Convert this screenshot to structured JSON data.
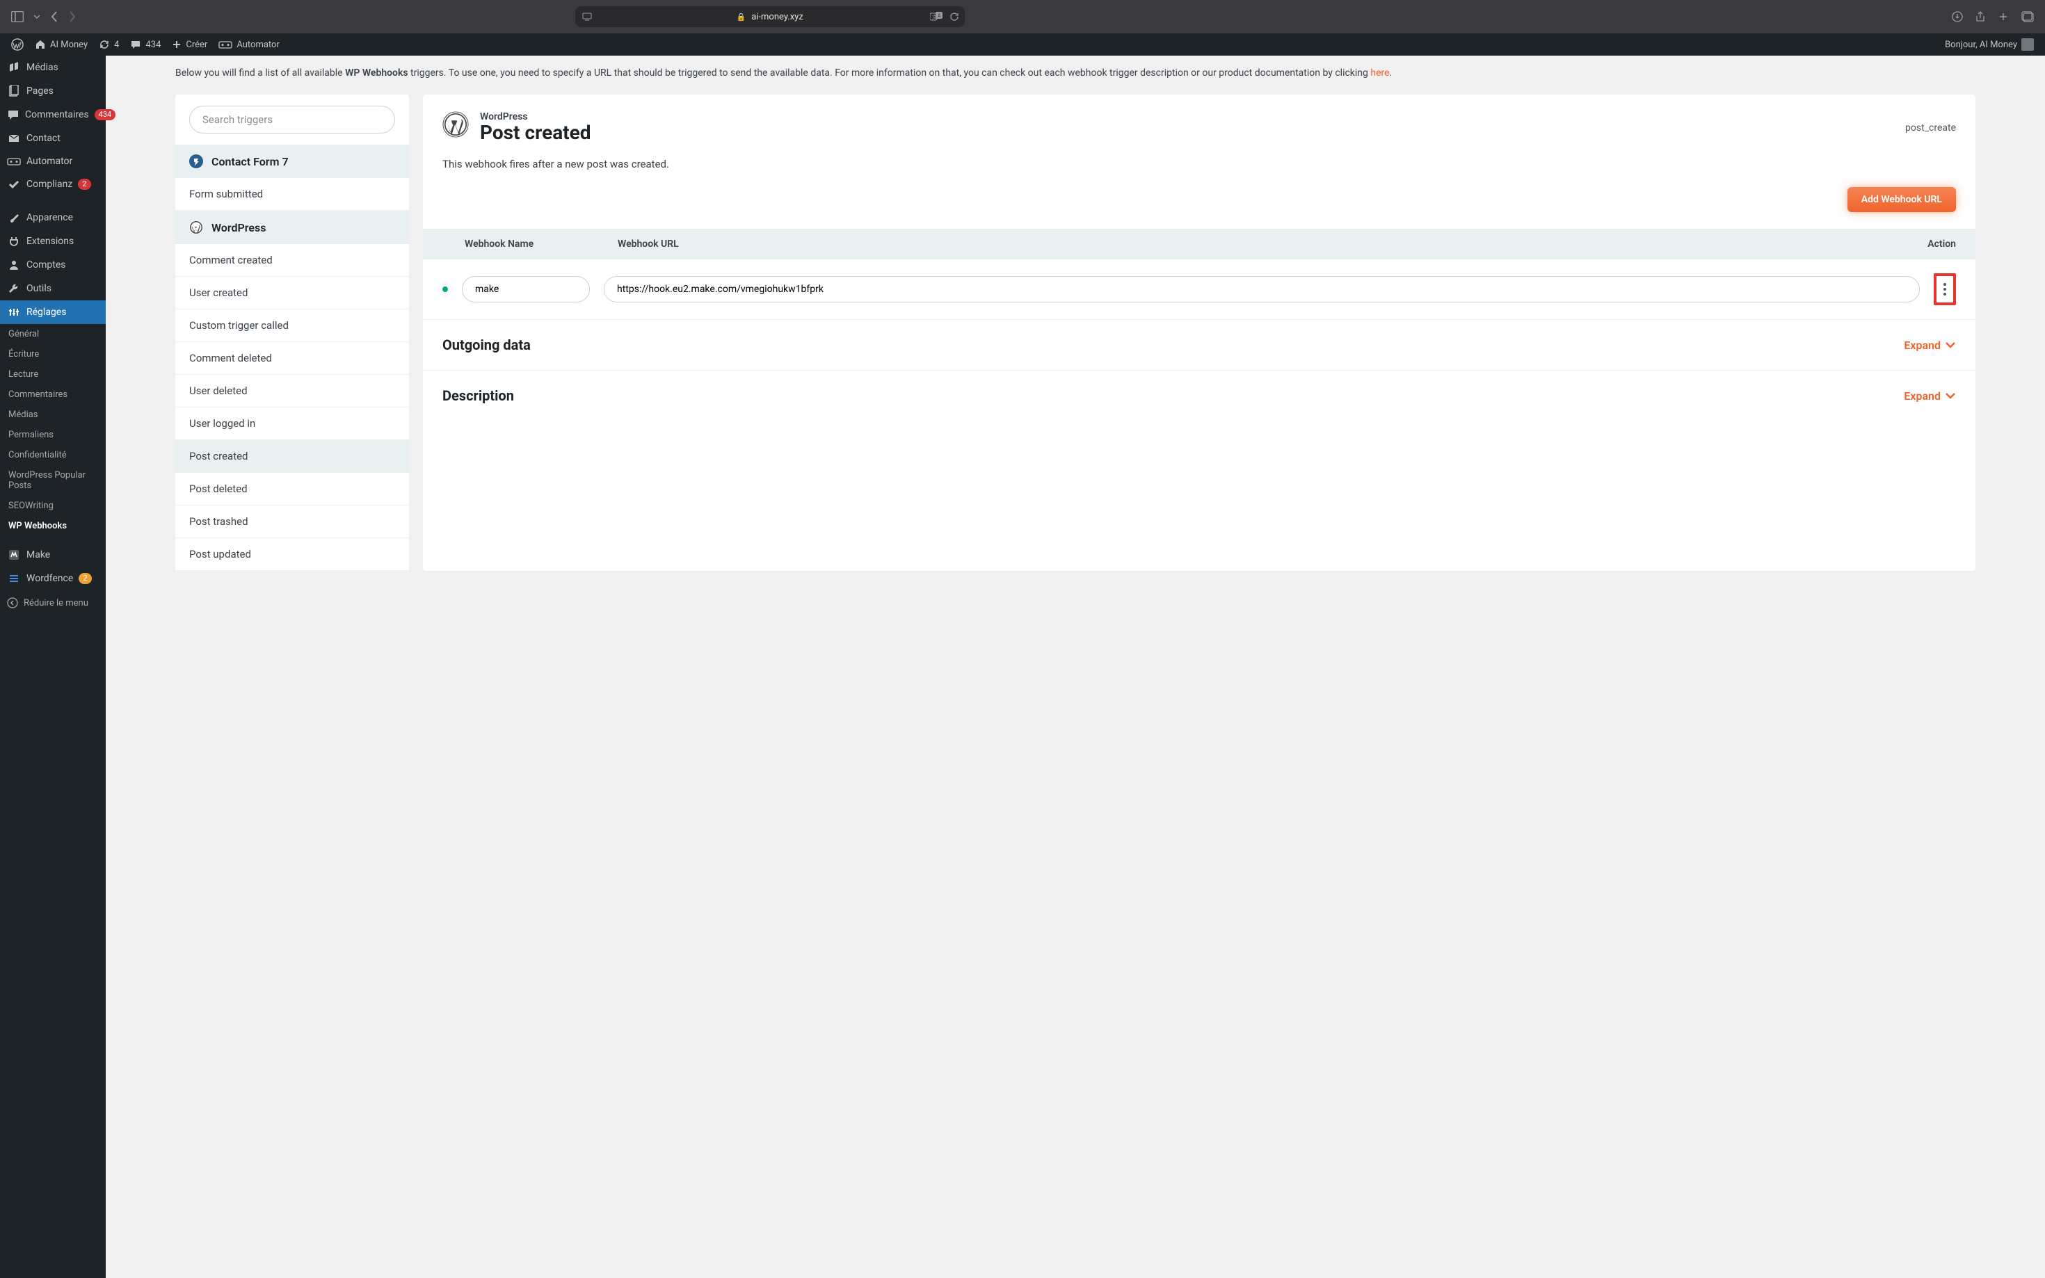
{
  "browser": {
    "url": "ai-money.xyz"
  },
  "adminBar": {
    "siteName": "AI Money",
    "updates": "4",
    "comments": "434",
    "create": "Créer",
    "automator": "Automator",
    "greeting": "Bonjour, AI Money"
  },
  "sidebar": {
    "items": [
      {
        "label": "Médias",
        "icon": "media"
      },
      {
        "label": "Pages",
        "icon": "page"
      },
      {
        "label": "Commentaires",
        "icon": "comment",
        "badge": "434",
        "badgeColor": "red"
      },
      {
        "label": "Contact",
        "icon": "mail"
      },
      {
        "label": "Automator",
        "icon": "automator"
      },
      {
        "label": "Complianz",
        "icon": "check",
        "badge": "2",
        "badgeColor": "red"
      },
      {
        "label": "Apparence",
        "icon": "brush"
      },
      {
        "label": "Extensions",
        "icon": "plug"
      },
      {
        "label": "Comptes",
        "icon": "user"
      },
      {
        "label": "Outils",
        "icon": "tool"
      },
      {
        "label": "Réglages",
        "icon": "settings",
        "active": true
      },
      {
        "label": "Make",
        "icon": "make"
      },
      {
        "label": "Wordfence",
        "icon": "wordfence",
        "badge": "2",
        "badgeColor": "orange"
      }
    ],
    "subItems": [
      {
        "label": "Général"
      },
      {
        "label": "Écriture"
      },
      {
        "label": "Lecture"
      },
      {
        "label": "Commentaires"
      },
      {
        "label": "Médias"
      },
      {
        "label": "Permaliens"
      },
      {
        "label": "Confidentialité"
      },
      {
        "label": "WordPress Popular Posts"
      },
      {
        "label": "SEOWriting"
      },
      {
        "label": "WP Webhooks",
        "active": true
      }
    ],
    "collapse": "Réduire le menu"
  },
  "intro": {
    "prefix": "Below you will find a list of all available ",
    "bold": "WP Webhooks",
    "middle": " triggers. To use one, you need to specify a URL that should be triggered to send the available data. For more information on that, you can check out each webhook trigger description or our product documentation by clicking ",
    "link": "here",
    "suffix": "."
  },
  "triggers": {
    "searchPlaceholder": "Search triggers",
    "groups": [
      {
        "name": "Contact Form 7",
        "icon": "cf7",
        "items": [
          {
            "label": "Form submitted"
          }
        ]
      },
      {
        "name": "WordPress",
        "icon": "wp",
        "items": [
          {
            "label": "Comment created"
          },
          {
            "label": "User created"
          },
          {
            "label": "Custom trigger called"
          },
          {
            "label": "Comment deleted"
          },
          {
            "label": "User deleted"
          },
          {
            "label": "User logged in"
          },
          {
            "label": "Post created",
            "selected": true
          },
          {
            "label": "Post deleted"
          },
          {
            "label": "Post trashed"
          },
          {
            "label": "Post updated"
          }
        ]
      }
    ]
  },
  "detail": {
    "integration": "WordPress",
    "title": "Post created",
    "slug": "post_create",
    "description": "This webhook fires after a new post was created.",
    "addButton": "Add Webhook URL",
    "table": {
      "colName": "Webhook Name",
      "colUrl": "Webhook URL",
      "colAction": "Action"
    },
    "webhooks": [
      {
        "name": "make",
        "url": "https://hook.eu2.make.com/vmegiohukw1bfprk"
      }
    ],
    "sections": [
      {
        "title": "Outgoing data",
        "action": "Expand"
      },
      {
        "title": "Description",
        "action": "Expand"
      }
    ]
  }
}
